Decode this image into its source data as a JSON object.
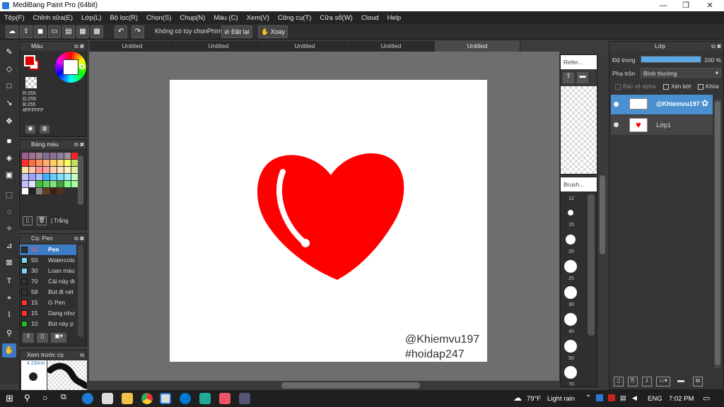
{
  "window": {
    "title": "MediBang Paint Pro (64bit)",
    "min": "—",
    "max": "❐",
    "close": "✕"
  },
  "menu": [
    "Tệp(F)",
    "Chỉnh sửa(E)",
    "Lớp(L)",
    "Bộ lọc(R)",
    "Chọn(S)",
    "Chụp(N)",
    "Màu (C)",
    "Xem(V)",
    "Công cụ(T)",
    "Cửa sổ(W)",
    "Cloud",
    "Help"
  ],
  "toolbar": {
    "selection_label": "Không có tùy chọn",
    "key_label": "Phím",
    "reset_label": "Đặt lại",
    "rotate_label": "Xoay"
  },
  "tabs": [
    "Untitled",
    "Untitled",
    "Untitled",
    "Untitled",
    "Untitled"
  ],
  "color_panel": {
    "title": "Màu",
    "r": "R:255",
    "g": "G:255",
    "b": "B:255",
    "hex": "#FFFFFF",
    "primary": "#e00000",
    "secondary": "#ffffff"
  },
  "palette_panel": {
    "title": "Bảng màu",
    "current": "Trắng"
  },
  "palette": [
    "#a06090",
    "#a07090",
    "#a08090",
    "#807090",
    "#907090",
    "#9080a0",
    "#a090a0",
    "#ff2020",
    "#ff3030",
    "#ff7040",
    "#ff9060",
    "#ffb070",
    "#ffd060",
    "#ffe070",
    "#ffff60",
    "#c0e060",
    "#ffe0a0",
    "#ffc0b0",
    "#ff9090",
    "#ffa0a0",
    "#ffd0b0",
    "#ffe0c0",
    "#fff0c0",
    "#e0f0a0",
    "#c0c0ff",
    "#a0a0ff",
    "#a0c0ff",
    "#40b0ff",
    "#60d0ff",
    "#80e0ff",
    "#a0f0ff",
    "#c0ffc0",
    "#c0c0ff",
    "#e0e0ff",
    "#40c040",
    "#60d060",
    "#80e080",
    "#40a040",
    "#80ff80",
    "#a0ffa0",
    "#ffffff",
    "#202020",
    "#808080",
    "#604020",
    "#402010",
    "#503020"
  ],
  "brush_panel": {
    "title": "Cọ: Pen",
    "items": [
      {
        "size": "50",
        "name": "Pen",
        "color": "#333333",
        "selected": true
      },
      {
        "size": "50",
        "name": "Watercolor",
        "color": "#7fd3f0",
        "selected": false
      },
      {
        "size": "30",
        "name": "Loan màu",
        "color": "#7fd3f0",
        "selected": false
      },
      {
        "size": "70",
        "name": "Cái này đó",
        "color": "#333333",
        "selected": false
      },
      {
        "size": "58",
        "name": "Bút đi nét",
        "color": "#333333",
        "selected": false
      },
      {
        "size": "15",
        "name": "G Pen",
        "color": "#ff3030",
        "selected": false
      },
      {
        "size": "15",
        "name": "Dạng nhuyễn",
        "color": "#ff3030",
        "selected": false
      },
      {
        "size": "10",
        "name": "Bút này p",
        "color": "#20c020",
        "selected": false
      }
    ]
  },
  "preview_panel": {
    "title": "Xem trước cọ",
    "size": "4.23mm"
  },
  "reference_panel": {
    "title": "Refer..."
  },
  "brush_size_panel": {
    "title": "Brush...",
    "sizes": [
      "12",
      "15",
      "20",
      "25",
      "30",
      "40",
      "50",
      "70"
    ]
  },
  "layer_panel": {
    "title": "Lớp",
    "opacity_label": "Độ trong",
    "opacity_value": "100 %",
    "opacity": 1.0,
    "blend_label": "Pha trộn",
    "blend_value": "Bình thường",
    "protect_alpha": "Bảo vệ alpha",
    "clipping": "Xén bớt",
    "lock": "Khóa",
    "layers": [
      {
        "name": "@Khiemvu197",
        "selected": true
      },
      {
        "name": "Lớp1",
        "selected": false
      }
    ]
  },
  "canvas": {
    "watermark1": "@Khiemvu197",
    "watermark2": "#hoidap247"
  },
  "taskbar": {
    "weather": "79°F",
    "weather_desc": "Light rain",
    "lang": "ENG",
    "time": "7:02 PM"
  }
}
